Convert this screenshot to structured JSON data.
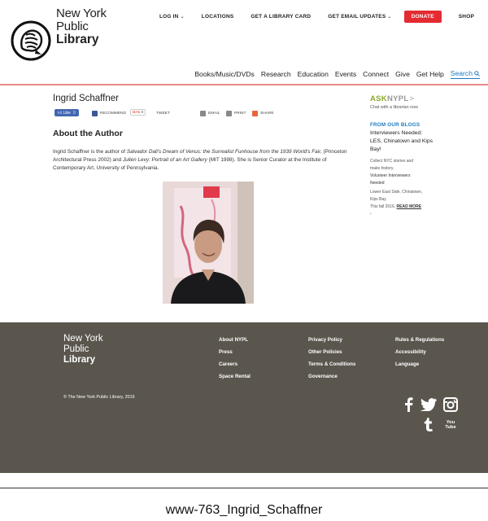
{
  "header": {
    "logo": {
      "line1": "New York",
      "line2": "Public",
      "line3": "Library"
    },
    "utility": [
      {
        "label": "LOG IN",
        "caret": "⌄"
      },
      {
        "label": "LOCATIONS"
      },
      {
        "label": "GET A LIBRARY CARD"
      },
      {
        "label": "GET EMAIL UPDATES",
        "caret": "⌄"
      },
      {
        "label": "DONATE"
      },
      {
        "label": "SHOP"
      }
    ],
    "nav": [
      "Books/Music/DVDs",
      "Research",
      "Education",
      "Events",
      "Connect",
      "Give",
      "Get Help"
    ],
    "search_label": "Search",
    "colors": {
      "accent_red": "#e32b31",
      "link_blue": "#1b7bc2",
      "footer_bg": "#5a564e",
      "ask_green": "#8aaa2c"
    }
  },
  "page": {
    "title": "Ingrid Schaffner",
    "share": {
      "like": "Like",
      "like_count": "0",
      "recommend": "RECOMMEND",
      "gplus": "G+1",
      "gplus_count": "0",
      "tweet": "TWEET",
      "email": "EMAIL",
      "print": "PRINT",
      "share": "SHARE"
    },
    "section_title": "About the Author",
    "bio": {
      "p1": "Ingrid Schaffner is the author of ",
      "book1": "Salvador Dali's Dream of Venus: the Surrealist Funhouse from the 1939 World's Fair,",
      "p2": " (Princeton Architectural Press 2002) and ",
      "book2": "Julien Levy: Portrait of an Art Gallery",
      "p3": " (MIT 1998). She is Senior Curator at the Institute of Contemporary Art, University of Pennsylvania."
    }
  },
  "rail": {
    "ask1": "ASK",
    "ask2": "NYPL",
    "ask_chev": ">",
    "ask_sub": "Chat with a librarian now",
    "blogs_head": "FROM OUR BLOGS",
    "blog_title": "Interviewers Needed: LES, Chinatown and Kips Bay!",
    "blog_lines": [
      "Collect NYC stories and",
      "make history."
    ],
    "blog_dark_lines": [
      "Volunteer Interviewers",
      "Needed"
    ],
    "blog_lines2": [
      "Lower East Side, Chinatown,",
      "Kips Bay",
      "This fall 2016,"
    ],
    "read_more": "READ MORE",
    "after": "›"
  },
  "footer": {
    "logo": {
      "line1": "New York",
      "line2": "Public",
      "line3": "Library"
    },
    "col1": [
      "About NYPL",
      "Press",
      "Careers",
      "Space Rental"
    ],
    "col2": [
      "Privacy Policy",
      "Other Policies",
      "Terms & Conditions",
      "Governance"
    ],
    "col3": [
      "Rules & Regulations",
      "Accessibility",
      "Language"
    ],
    "copyright": "© The New York Public Library, 2016",
    "social_icons": [
      "facebook-icon",
      "twitter-icon",
      "instagram-icon",
      "tumblr-icon",
      "youtube-icon"
    ],
    "youtube_you": "You",
    "youtube_tube": "Tube"
  },
  "caption": "www-763_Ingrid_Schaffner"
}
